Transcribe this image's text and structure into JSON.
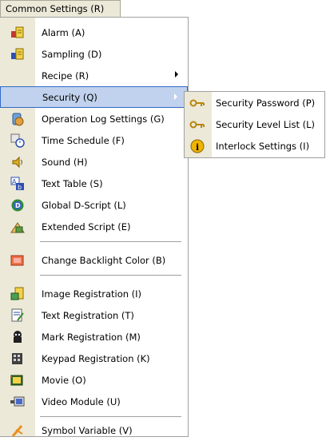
{
  "menubar": {
    "label": "Common Settings (R)"
  },
  "menu": {
    "items": [
      {
        "label": "Alarm (A)",
        "icon": "alarm-icon"
      },
      {
        "label": "Sampling (D)",
        "icon": "sampling-icon"
      },
      {
        "label": "Recipe (R)",
        "icon": "",
        "submenu": true
      },
      {
        "label": "Security (Q)",
        "icon": "",
        "submenu": true,
        "highlighted": true
      },
      {
        "label": "Operation Log Settings (G)",
        "icon": "operation-log-icon"
      },
      {
        "label": "Time Schedule (F)",
        "icon": "time-schedule-icon"
      },
      {
        "label": "Sound (H)",
        "icon": "sound-icon"
      },
      {
        "label": "Text Table (S)",
        "icon": "text-table-icon"
      },
      {
        "label": "Global D-Script (L)",
        "icon": "global-dscript-icon"
      },
      {
        "label": "Extended Script (E)",
        "icon": "extended-script-icon"
      },
      {
        "label": "Change Backlight Color (B)",
        "icon": "backlight-icon"
      },
      {
        "label": "Image Registration (I)",
        "icon": "image-registration-icon"
      },
      {
        "label": "Text Registration (T)",
        "icon": "text-registration-icon"
      },
      {
        "label": "Mark Registration (M)",
        "icon": "mark-registration-icon"
      },
      {
        "label": "Keypad Registration (K)",
        "icon": "keypad-registration-icon"
      },
      {
        "label": "Movie (O)",
        "icon": "movie-icon"
      },
      {
        "label": "Video Module (U)",
        "icon": "video-module-icon"
      },
      {
        "label": "Symbol Variable (V)",
        "icon": "symbol-variable-icon"
      }
    ]
  },
  "submenu": {
    "items": [
      {
        "label": "Security Password (P)",
        "icon": "key-icon"
      },
      {
        "label": "Security Level List (L)",
        "icon": "key-icon"
      },
      {
        "label": "Interlock Settings (I)",
        "icon": "info-icon"
      }
    ]
  },
  "colors": {
    "highlight": "#c1d2ee",
    "highlight_border": "#316ac5",
    "gutter": "#ece9d8"
  }
}
